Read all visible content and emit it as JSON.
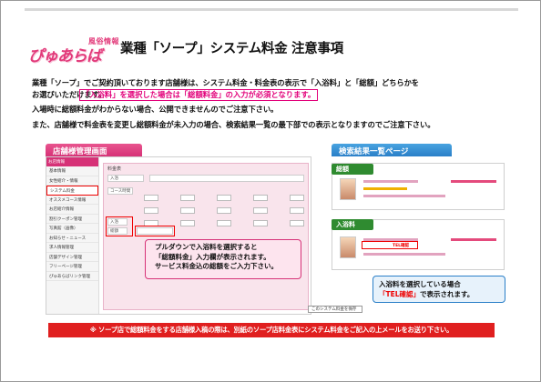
{
  "logo": {
    "small": "風俗情報",
    "main": "ぴゅあらば"
  },
  "title": "業種「ソープ」システム料金 注意事項",
  "paragraphs": {
    "p1": "業種「ソープ」でご契約頂いております店舗様は、システム料金・料金表の表示で「入浴料」と「総額」どちらかを",
    "p2": "お選びいただけます。",
    "p2_highlight": "「入浴料」を選択した場合は「総額料金」の入力が必須となります。",
    "p4": "入場時に総額料金がわからない場合、公開できませんのでご注意下さい。",
    "p5": "また、店舗様で料金表を変更し総額料金が未入力の場合、検索結果一覧の最下部での表示となりますのでご注意下さい。"
  },
  "sections": {
    "admin": "店舗様管理画面",
    "search": "検索結果一覧ページ"
  },
  "admin_panel": {
    "side_header": "お店情報",
    "side_items": [
      "基本情報",
      "女性紹介・情報",
      "システム料金",
      "オススメコース情報",
      "お店紹介情報",
      "割引クーポン管理",
      "写真館（画像）",
      "お知らせ・ニュース",
      "求人情報管理",
      "店舗デザイン管理",
      "フリーページ管理",
      "ぴゅあらばリンク管理"
    ],
    "form_title": "料金表",
    "field1": "入浴",
    "field2": "コース時間",
    "field3": "総額",
    "button": "このシステム料金を保存"
  },
  "callout1": [
    "プルダウンで入浴料を選択すると",
    "「総額料金」入力欄が表示されます。",
    "サービス料金込の総額をご入力下さい。"
  ],
  "result_tags": {
    "total": "総額",
    "bath": "入浴料"
  },
  "result_tel": "TEL確認",
  "callout2": {
    "line1": "入浴料を選択している場合",
    "line2_red": "「TEL確認」",
    "line2_rest": "で表示されます。"
  },
  "footer": "※ ソープ店で総額料金をする店舗様入稿の際は、別紙のソープ店料金表にシステム料金をご記入の上メールをお送り下さい。"
}
